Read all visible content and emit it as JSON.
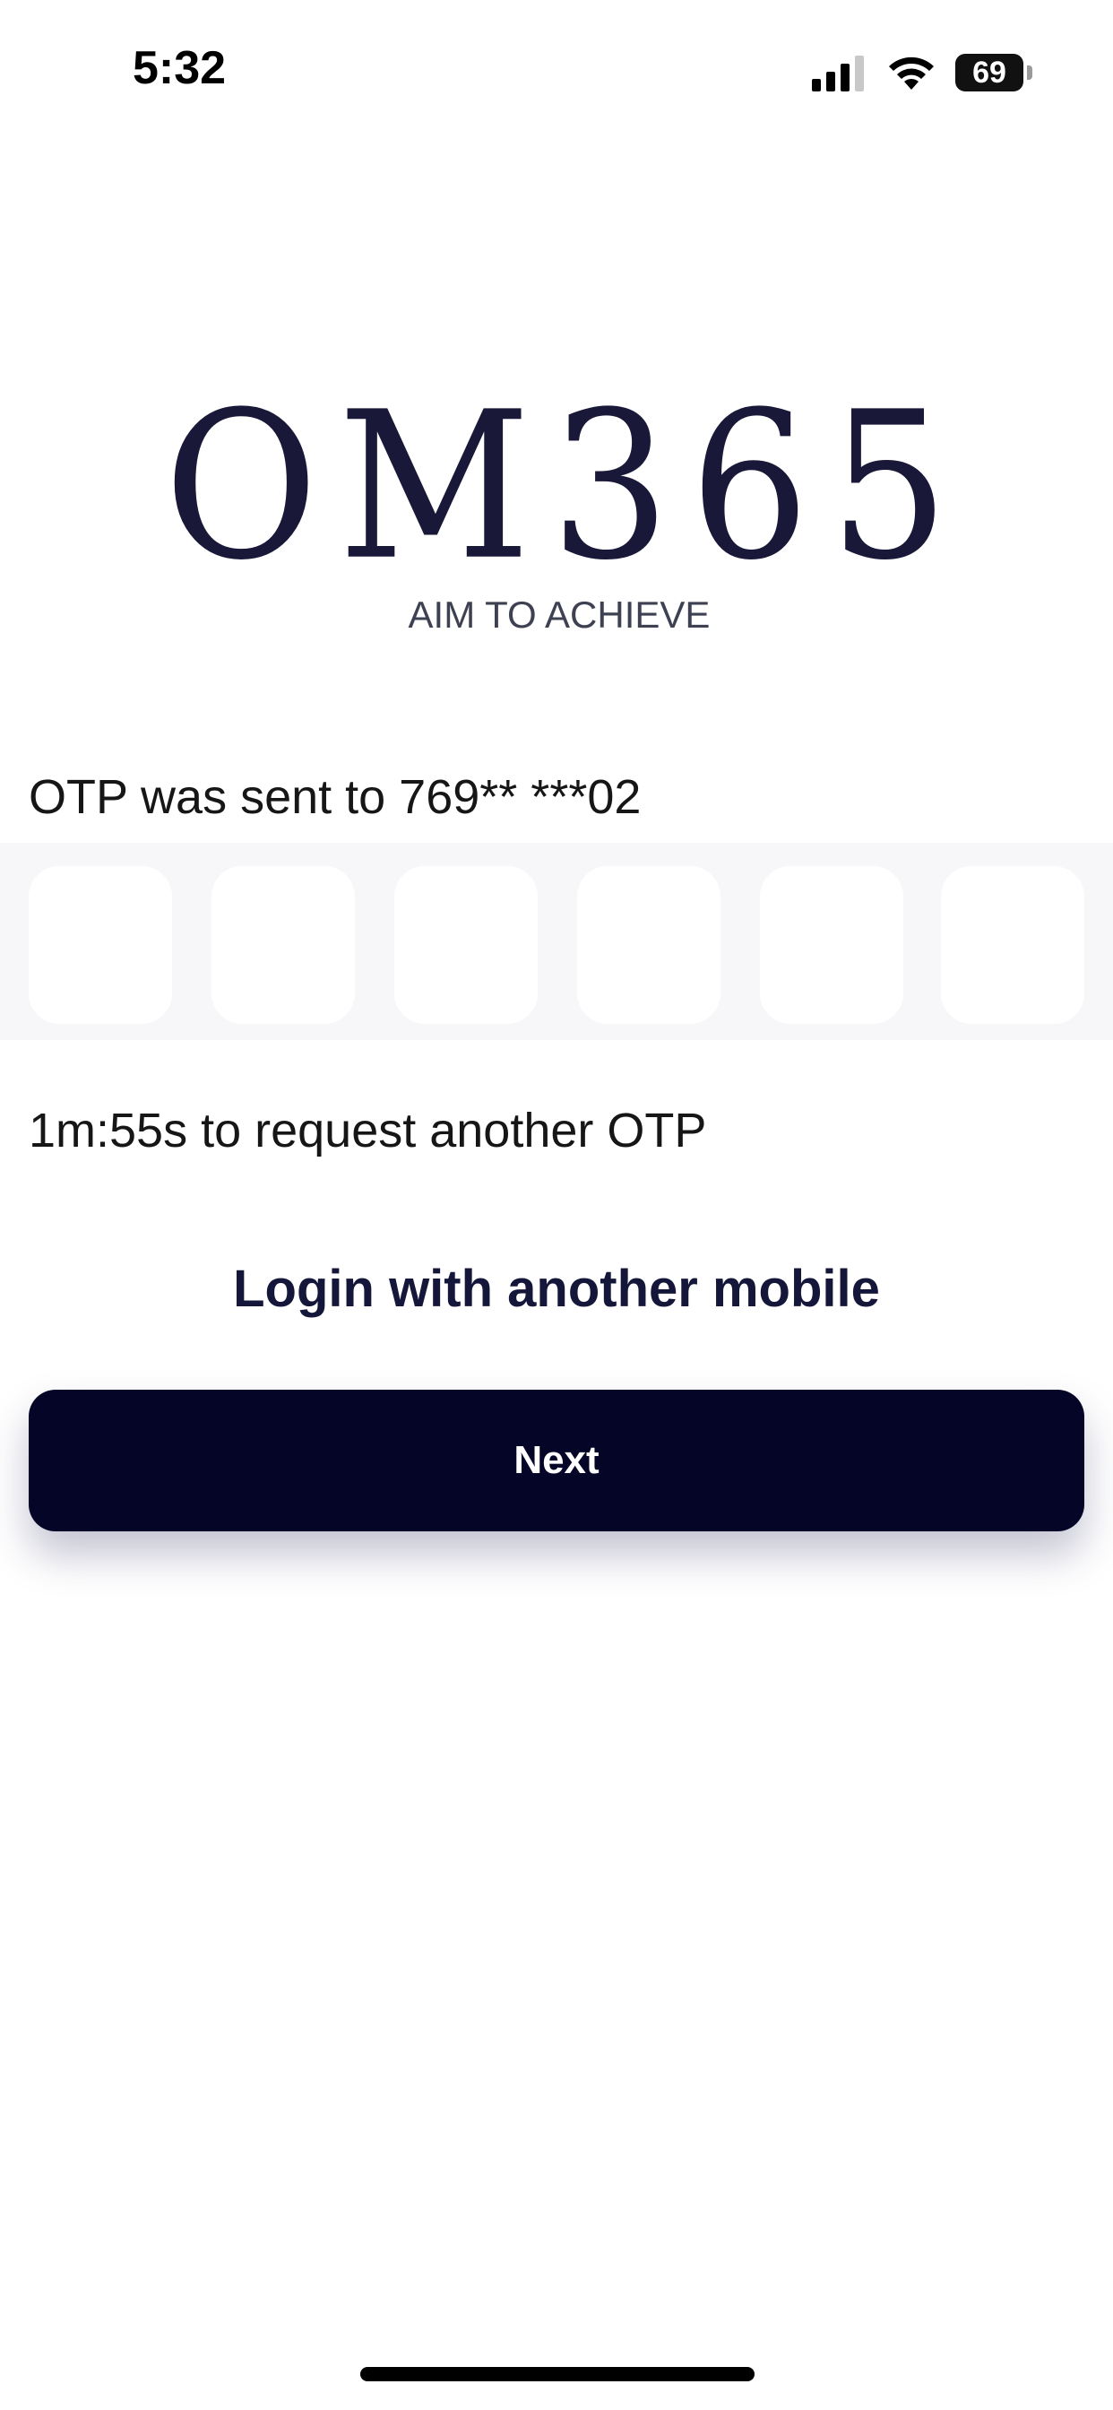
{
  "status_bar": {
    "time": "5:32",
    "battery_level": "69",
    "icons": [
      "signal-icon",
      "wifi-icon",
      "battery-icon"
    ]
  },
  "brand": {
    "wordmark": "OM365",
    "tagline": "AIM TO ACHIEVE",
    "color": "#1a1838"
  },
  "otp": {
    "sent_message": "OTP was sent to 769** ***02",
    "digit_count": 6,
    "digits": [
      "",
      "",
      "",
      "",
      "",
      ""
    ],
    "resend_timer": "1m:55s to request another OTP"
  },
  "actions": {
    "login_another_label": "Login with another mobile",
    "next_label": "Next"
  },
  "colors": {
    "primary_button": "#050627",
    "link_text": "#15173a",
    "background": "#ffffff"
  }
}
